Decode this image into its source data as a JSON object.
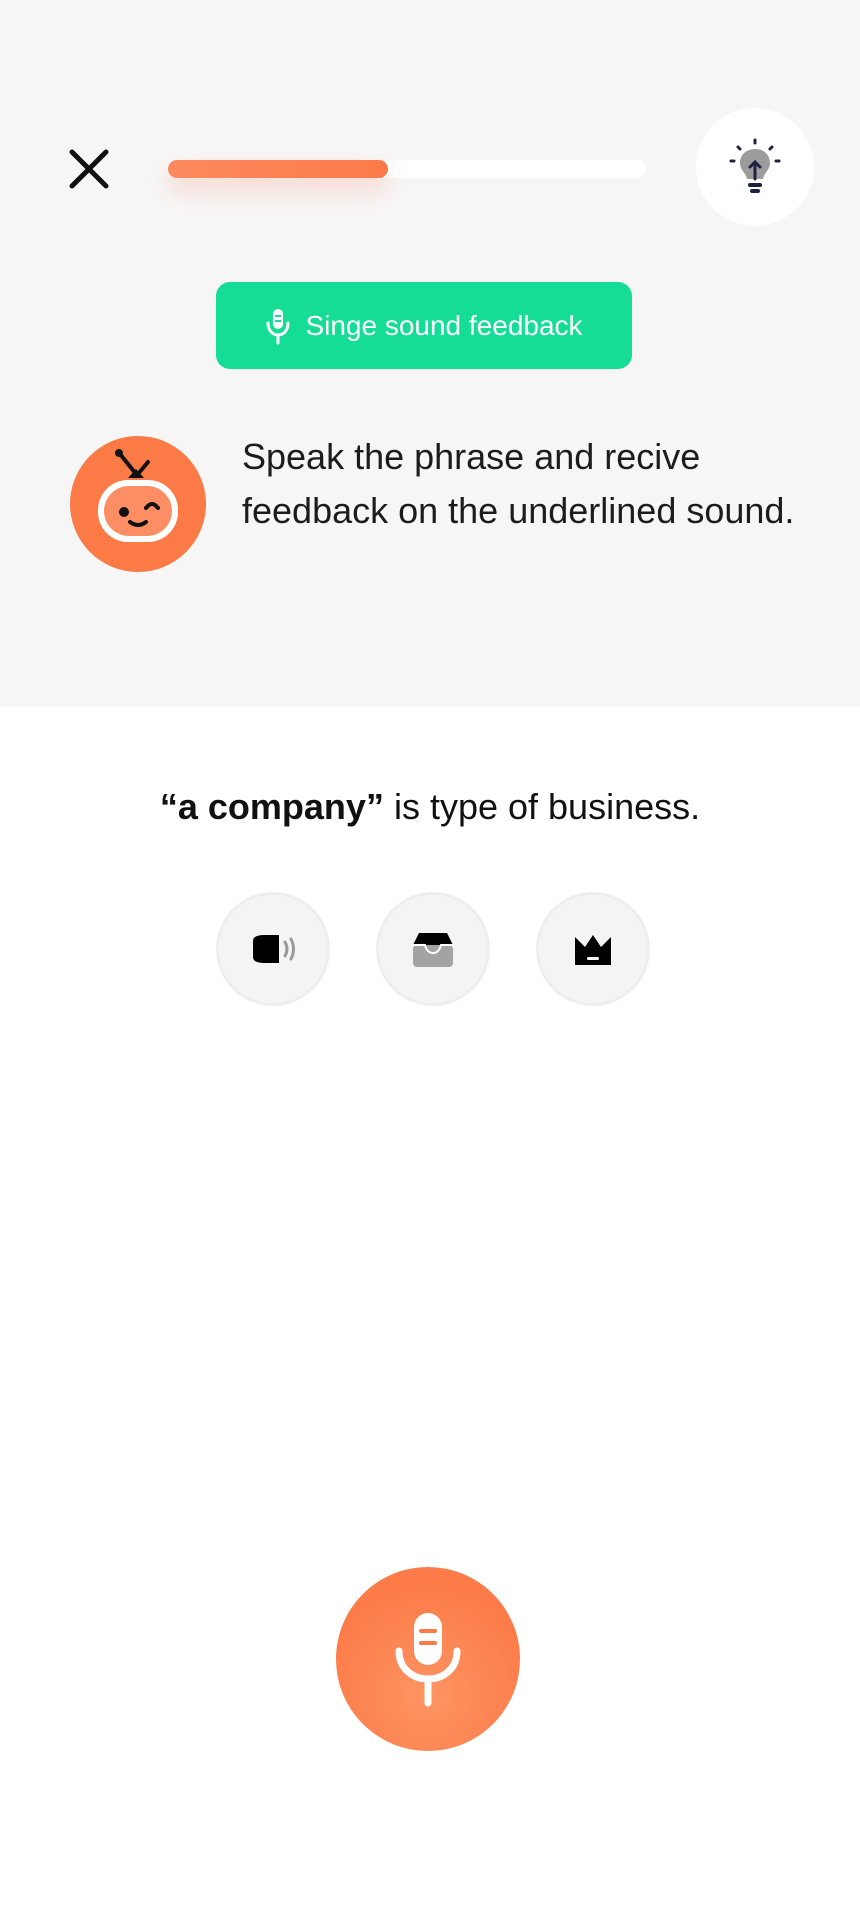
{
  "header": {
    "progress_fraction": 0.46
  },
  "badge": {
    "label": "Singe sound feedback",
    "icon": "microphone-icon"
  },
  "instruction": {
    "text": "Speak the phrase and recive feedback on the underlined sound."
  },
  "phrase": {
    "highlight": "“a company”",
    "rest": " is type of business."
  },
  "tools": [
    {
      "name": "speaker-button",
      "icon": "speaker-icon"
    },
    {
      "name": "save-button",
      "icon": "inbox-tray-icon"
    },
    {
      "name": "premium-button",
      "icon": "crown-icon"
    }
  ],
  "colors": {
    "accent_orange": "#fc7a46",
    "badge_green": "#15dd96",
    "top_background": "#f7f6f6"
  }
}
